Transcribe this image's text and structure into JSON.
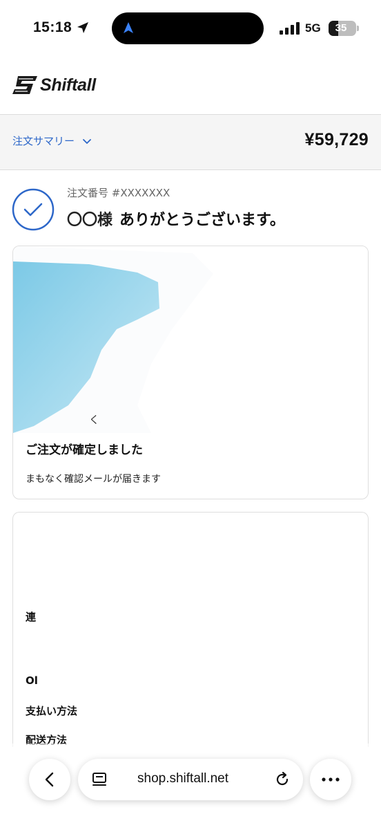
{
  "status_bar": {
    "time": "15:18",
    "network": "5G",
    "battery": "35",
    "battery_level": 0.35
  },
  "header": {
    "logo_text": "Shiftall",
    "logo_icon": "shiftall-logo-icon"
  },
  "summary": {
    "label": "注文サマリー",
    "total": "¥59,729",
    "accent": "#2d67c9"
  },
  "confirmation": {
    "order_number": "注文番号 #XXXXXXX",
    "customer_name": "〇〇様",
    "thanks": "ありがとうございます。",
    "check_color": "#2d67c9"
  },
  "card1": {
    "map_label": "く",
    "title": "ご注文が確定しました",
    "subtitle": "まもなく確認メールが届きます"
  },
  "card2": {
    "labels": [
      "連",
      "Ol",
      "支払い方法",
      "配送方法"
    ]
  },
  "browser": {
    "url": "shop.shiftall.net",
    "icons": [
      "back-icon",
      "tab-view-icon",
      "reload-icon",
      "more-icon"
    ]
  }
}
